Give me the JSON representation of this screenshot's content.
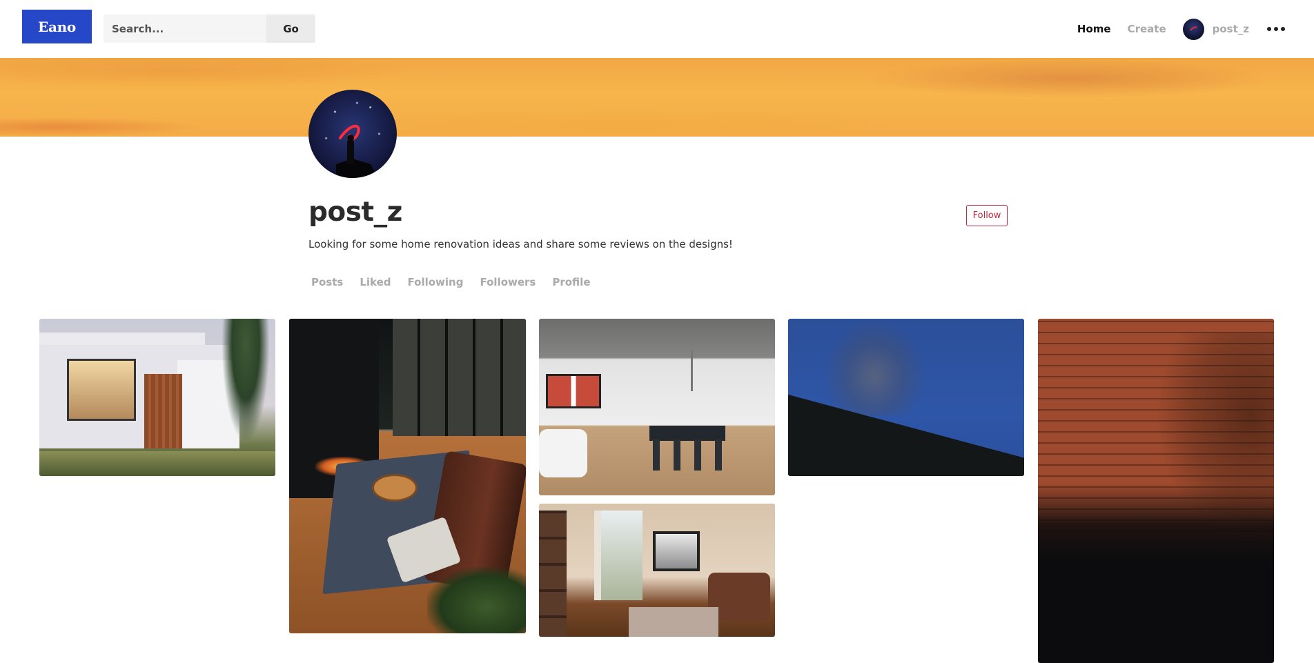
{
  "header": {
    "logo_text": "Eano",
    "search": {
      "placeholder": "Search...",
      "value": ""
    },
    "go_label": "Go",
    "nav": {
      "home": "Home",
      "create": "Create",
      "username": "post_z",
      "more_icon": "more-horizontal-icon"
    }
  },
  "profile": {
    "name": "post_z",
    "bio": "Looking for some home renovation ideas and share some reviews on the designs!",
    "follow_label": "Follow",
    "tabs": [
      "Posts",
      "Liked",
      "Following",
      "Followers",
      "Profile"
    ]
  },
  "colors": {
    "brand": "#2747c9",
    "follow_accent": "#c2263e",
    "muted_text": "#aaaaaa",
    "banner": "#f4ab47"
  }
}
